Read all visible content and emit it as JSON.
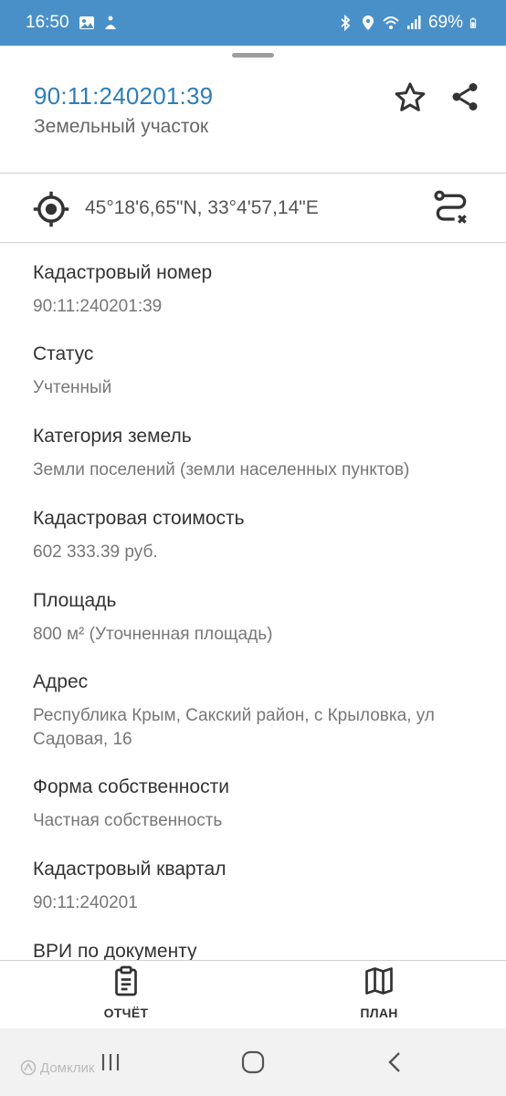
{
  "status_bar": {
    "time": "16:50",
    "battery": "69%",
    "background": "#4a90c8"
  },
  "header": {
    "title": "90:11:240201:39",
    "subtitle": "Земельный участок",
    "accent": "#2e7db8"
  },
  "coords": {
    "text": "45°18'6,65\"N, 33°4'57,14\"E"
  },
  "fields": [
    {
      "label": "Кадастровый номер",
      "value": "90:11:240201:39"
    },
    {
      "label": "Статус",
      "value": "Учтенный"
    },
    {
      "label": "Категория земель",
      "value": "Земли поселений (земли населенных пунктов)"
    },
    {
      "label": "Кадастровая стоимость",
      "value": "602 333.39 руб."
    },
    {
      "label": "Площадь",
      "value": "800 м² (Уточненная площадь)"
    },
    {
      "label": "Адрес",
      "value": "Республика Крым,  Сакский район, с Крыловка, ул Садовая,  16"
    },
    {
      "label": "Форма собственности",
      "value": "Частная собственность"
    },
    {
      "label": "Кадастровый квартал",
      "value": "90:11:240201"
    },
    {
      "label": "ВРИ по документу",
      "value": ""
    }
  ],
  "bottom_nav": {
    "report_label": "ОТЧЁТ",
    "plan_label": "ПЛАН"
  },
  "watermark": "Домклик"
}
